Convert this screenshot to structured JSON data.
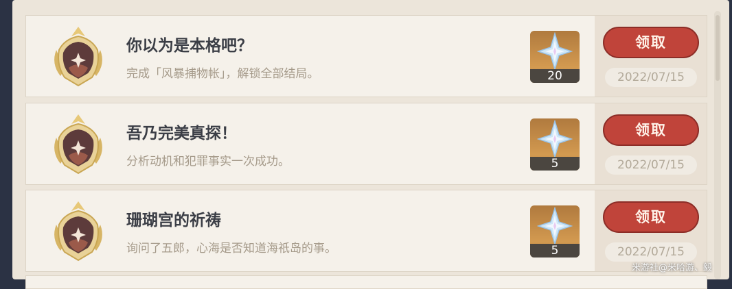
{
  "achievements": [
    {
      "title": "你以为是本格吧？",
      "description": "完成「风暴捕物帐」，解锁全部结局。",
      "reward_icon": "primogem-icon",
      "reward_qty": "20",
      "claim_label": "领取",
      "date": "2022/07/15"
    },
    {
      "title": "吾乃完美真探！",
      "description": "分析动机和犯罪事实一次成功。",
      "reward_icon": "primogem-icon",
      "reward_qty": "5",
      "claim_label": "领取",
      "date": "2022/07/15"
    },
    {
      "title": "珊瑚宫的祈祷",
      "description": "询问了五郎，心海是否知道海祇岛的事。",
      "reward_icon": "primogem-icon",
      "reward_qty": "5",
      "claim_label": "领取",
      "date": "2022/07/15"
    }
  ],
  "watermark": "米游社@米哈游、毅",
  "colors": {
    "claim_button": "#c0443a",
    "row_background": "#f5f1ea",
    "reward_tile": "#c48d48"
  }
}
